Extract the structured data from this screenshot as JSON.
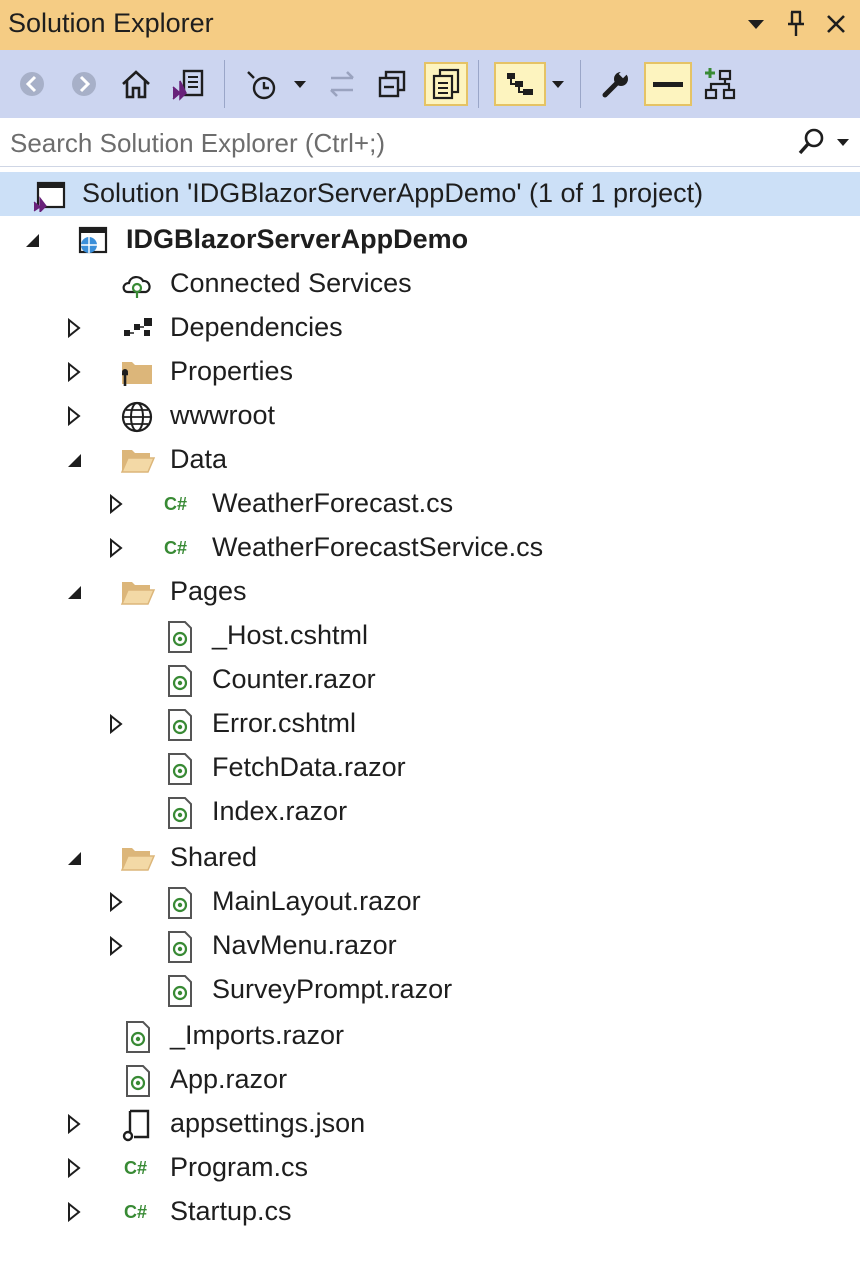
{
  "panel": {
    "title": "Solution Explorer"
  },
  "search": {
    "placeholder": "Search Solution Explorer (Ctrl+;)"
  },
  "solution": {
    "label": "Solution 'IDGBlazorServerAppDemo' (1 of 1 project)"
  },
  "tree": {
    "project": "IDGBlazorServerAppDemo",
    "connected_services": "Connected Services",
    "dependencies": "Dependencies",
    "properties": "Properties",
    "wwwroot": "wwwroot",
    "data": "Data",
    "weather_forecast": "WeatherForecast.cs",
    "weather_forecast_service": "WeatherForecastService.cs",
    "pages": "Pages",
    "host": "_Host.cshtml",
    "counter": "Counter.razor",
    "error": "Error.cshtml",
    "fetch_data": "FetchData.razor",
    "index": "Index.razor",
    "shared": "Shared",
    "main_layout": "MainLayout.razor",
    "nav_menu": "NavMenu.razor",
    "survey_prompt": "SurveyPrompt.razor",
    "imports": "_Imports.razor",
    "app": "App.razor",
    "appsettings": "appsettings.json",
    "program": "Program.cs",
    "startup": "Startup.cs"
  },
  "icons": {
    "csharp_glyph": "C#"
  },
  "colors": {
    "title_bar": "#f5cc84",
    "toolbar": "#ccd5f0",
    "selection": "#cce0f7",
    "folder": "#dcb67a",
    "csharp": "#388a34",
    "vs_purple": "#68217a"
  }
}
